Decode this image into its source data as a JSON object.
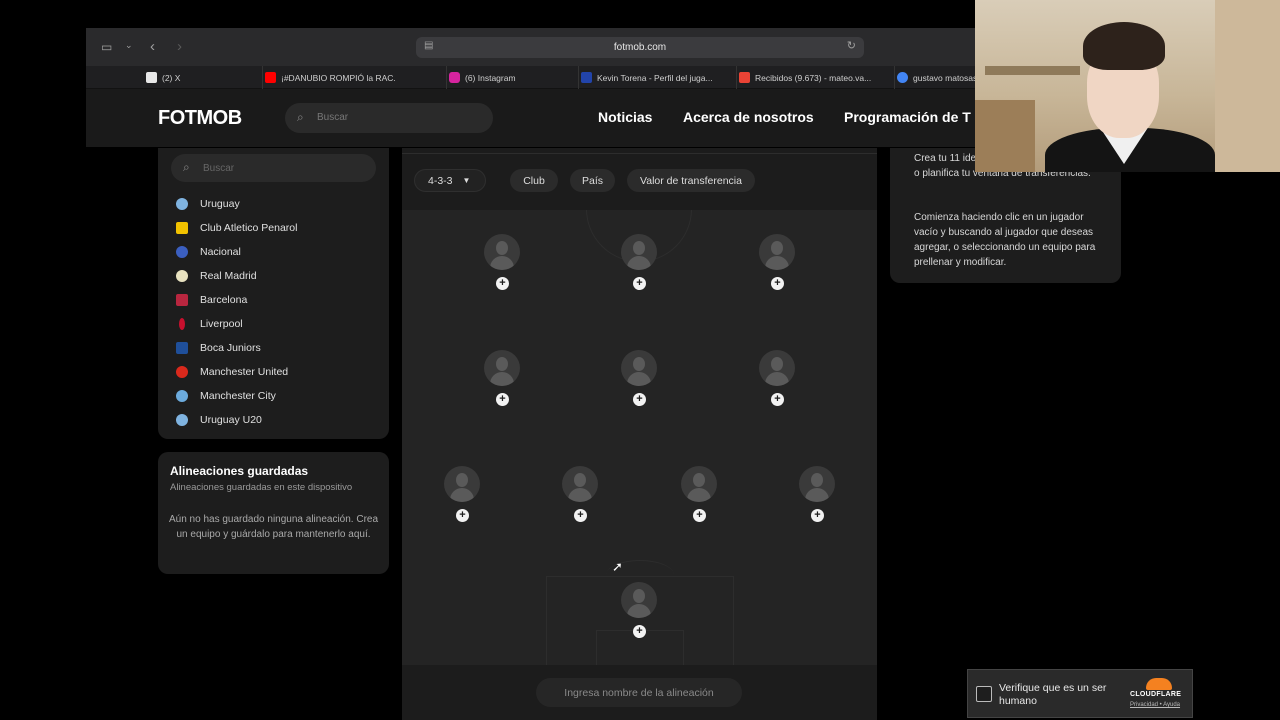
{
  "browser": {
    "url": "fotmob.com",
    "tabs": [
      {
        "label": "(2) X",
        "favicon_color": "#e8e8e8",
        "icon": "x-icon"
      },
      {
        "label": "¡#DANUBIO ROMPIÓ la RAC...",
        "favicon_color": "#ff0000",
        "icon": "youtube-icon"
      },
      {
        "label": "(6) Instagram",
        "favicon_color": "#d6249f",
        "icon": "instagram-icon"
      },
      {
        "label": "Kevin Torena - Perfil del juga...",
        "favicon_color": "#2244aa",
        "icon": "site-icon"
      },
      {
        "label": "Recibidos (9.673) - mateo.va...",
        "favicon_color": "#ea4335",
        "icon": "gmail-icon"
      },
      {
        "label": "gustavo matosas",
        "favicon_color": "#4285f4",
        "icon": "google-icon"
      }
    ]
  },
  "header": {
    "logo": "FOTMOB",
    "search_placeholder": "Buscar",
    "nav": [
      "Noticias",
      "Acerca de nosotros",
      "Programación de T"
    ]
  },
  "sidebar": {
    "search_placeholder": "Buscar",
    "teams": [
      {
        "name": "Uruguay",
        "color": "#7fb3e0"
      },
      {
        "name": "Club Atletico Penarol",
        "color": "#f2c200"
      },
      {
        "name": "Nacional",
        "color": "#3b5fc0"
      },
      {
        "name": "Real Madrid",
        "color": "#e8e2c0"
      },
      {
        "name": "Barcelona",
        "color": "#b8263f"
      },
      {
        "name": "Liverpool",
        "color": "#c8102e"
      },
      {
        "name": "Boca Juniors",
        "color": "#1f4f9a"
      },
      {
        "name": "Manchester United",
        "color": "#da291c"
      },
      {
        "name": "Manchester City",
        "color": "#6cabdd"
      },
      {
        "name": "Uruguay U20",
        "color": "#7fb3e0"
      }
    ]
  },
  "saved": {
    "title": "Alineaciones guardadas",
    "subtitle": "Alineaciones guardadas en este dispositivo",
    "empty": "Aún no has guardado ninguna alineación. Crea un equipo y guárdalo para mantenerlo aquí."
  },
  "builder": {
    "formation": "4-3-3",
    "filters": [
      "Club",
      "País",
      "Valor de transferencia"
    ],
    "lineup_placeholder": "Ingresa nombre de la alineación"
  },
  "info": {
    "p1": "Crea tu 11 ideal, la alineación de tu equipo o planifica tu ventana de transferencias.",
    "p2": "Comienza haciendo clic en un jugador vacío y buscando al jugador que deseas agregar, o seleccionando un equipo para prellenar y modificar."
  },
  "captcha": {
    "label": "Verifique que es un ser humano",
    "brand": "CLOUDFLARE",
    "links": "Privacidad • Ayuda",
    "brand_color": "#f48120"
  }
}
